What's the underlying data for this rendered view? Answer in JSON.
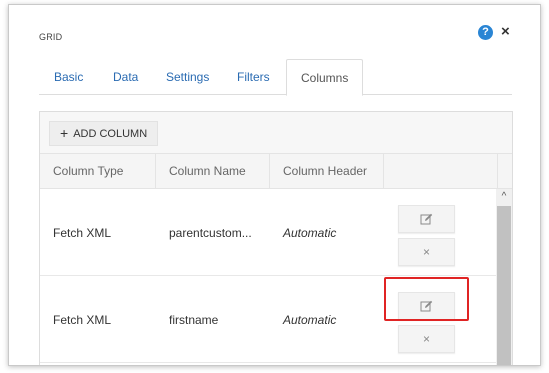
{
  "dialog": {
    "title": "GRID",
    "help_icon": "?",
    "close_icon": "×"
  },
  "tabs": [
    {
      "label": "Basic"
    },
    {
      "label": "Data"
    },
    {
      "label": "Settings"
    },
    {
      "label": "Filters"
    },
    {
      "label": "Columns",
      "active": true
    }
  ],
  "toolbar": {
    "add_column_label": "ADD COLUMN",
    "add_icon": "+"
  },
  "table": {
    "headers": [
      "Column Type",
      "Column Name",
      "Column Header"
    ],
    "rows": [
      {
        "type": "Fetch XML",
        "name": "parentcustom...",
        "header": "Automatic"
      },
      {
        "type": "Fetch XML",
        "name": "firstname",
        "header": "Automatic"
      }
    ],
    "edit_icon": "edit-icon",
    "delete_icon": "×"
  },
  "scrollbar": {
    "up_arrow": "^"
  },
  "colors": {
    "accent": "#2a6bb2",
    "help": "#2a85d4",
    "highlight": "#e02424"
  }
}
